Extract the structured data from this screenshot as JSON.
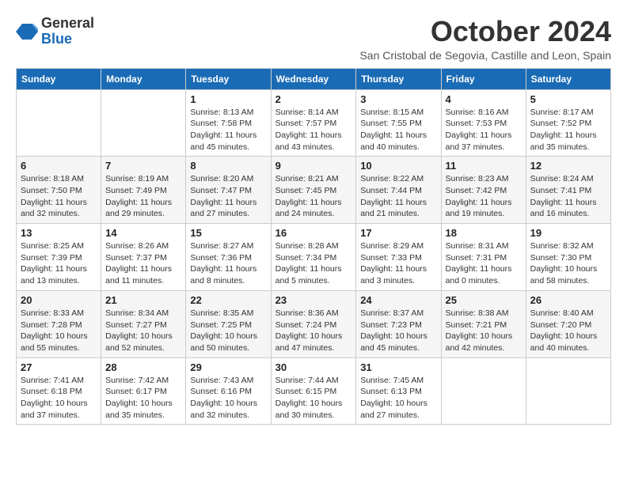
{
  "logo": {
    "general": "General",
    "blue": "Blue"
  },
  "title": "October 2024",
  "subtitle": "San Cristobal de Segovia, Castille and Leon, Spain",
  "weekdays": [
    "Sunday",
    "Monday",
    "Tuesday",
    "Wednesday",
    "Thursday",
    "Friday",
    "Saturday"
  ],
  "weeks": [
    [
      {
        "day": "",
        "info": ""
      },
      {
        "day": "",
        "info": ""
      },
      {
        "day": "1",
        "info": "Sunrise: 8:13 AM\nSunset: 7:58 PM\nDaylight: 11 hours and 45 minutes."
      },
      {
        "day": "2",
        "info": "Sunrise: 8:14 AM\nSunset: 7:57 PM\nDaylight: 11 hours and 43 minutes."
      },
      {
        "day": "3",
        "info": "Sunrise: 8:15 AM\nSunset: 7:55 PM\nDaylight: 11 hours and 40 minutes."
      },
      {
        "day": "4",
        "info": "Sunrise: 8:16 AM\nSunset: 7:53 PM\nDaylight: 11 hours and 37 minutes."
      },
      {
        "day": "5",
        "info": "Sunrise: 8:17 AM\nSunset: 7:52 PM\nDaylight: 11 hours and 35 minutes."
      }
    ],
    [
      {
        "day": "6",
        "info": "Sunrise: 8:18 AM\nSunset: 7:50 PM\nDaylight: 11 hours and 32 minutes."
      },
      {
        "day": "7",
        "info": "Sunrise: 8:19 AM\nSunset: 7:49 PM\nDaylight: 11 hours and 29 minutes."
      },
      {
        "day": "8",
        "info": "Sunrise: 8:20 AM\nSunset: 7:47 PM\nDaylight: 11 hours and 27 minutes."
      },
      {
        "day": "9",
        "info": "Sunrise: 8:21 AM\nSunset: 7:45 PM\nDaylight: 11 hours and 24 minutes."
      },
      {
        "day": "10",
        "info": "Sunrise: 8:22 AM\nSunset: 7:44 PM\nDaylight: 11 hours and 21 minutes."
      },
      {
        "day": "11",
        "info": "Sunrise: 8:23 AM\nSunset: 7:42 PM\nDaylight: 11 hours and 19 minutes."
      },
      {
        "day": "12",
        "info": "Sunrise: 8:24 AM\nSunset: 7:41 PM\nDaylight: 11 hours and 16 minutes."
      }
    ],
    [
      {
        "day": "13",
        "info": "Sunrise: 8:25 AM\nSunset: 7:39 PM\nDaylight: 11 hours and 13 minutes."
      },
      {
        "day": "14",
        "info": "Sunrise: 8:26 AM\nSunset: 7:37 PM\nDaylight: 11 hours and 11 minutes."
      },
      {
        "day": "15",
        "info": "Sunrise: 8:27 AM\nSunset: 7:36 PM\nDaylight: 11 hours and 8 minutes."
      },
      {
        "day": "16",
        "info": "Sunrise: 8:28 AM\nSunset: 7:34 PM\nDaylight: 11 hours and 5 minutes."
      },
      {
        "day": "17",
        "info": "Sunrise: 8:29 AM\nSunset: 7:33 PM\nDaylight: 11 hours and 3 minutes."
      },
      {
        "day": "18",
        "info": "Sunrise: 8:31 AM\nSunset: 7:31 PM\nDaylight: 11 hours and 0 minutes."
      },
      {
        "day": "19",
        "info": "Sunrise: 8:32 AM\nSunset: 7:30 PM\nDaylight: 10 hours and 58 minutes."
      }
    ],
    [
      {
        "day": "20",
        "info": "Sunrise: 8:33 AM\nSunset: 7:28 PM\nDaylight: 10 hours and 55 minutes."
      },
      {
        "day": "21",
        "info": "Sunrise: 8:34 AM\nSunset: 7:27 PM\nDaylight: 10 hours and 52 minutes."
      },
      {
        "day": "22",
        "info": "Sunrise: 8:35 AM\nSunset: 7:25 PM\nDaylight: 10 hours and 50 minutes."
      },
      {
        "day": "23",
        "info": "Sunrise: 8:36 AM\nSunset: 7:24 PM\nDaylight: 10 hours and 47 minutes."
      },
      {
        "day": "24",
        "info": "Sunrise: 8:37 AM\nSunset: 7:23 PM\nDaylight: 10 hours and 45 minutes."
      },
      {
        "day": "25",
        "info": "Sunrise: 8:38 AM\nSunset: 7:21 PM\nDaylight: 10 hours and 42 minutes."
      },
      {
        "day": "26",
        "info": "Sunrise: 8:40 AM\nSunset: 7:20 PM\nDaylight: 10 hours and 40 minutes."
      }
    ],
    [
      {
        "day": "27",
        "info": "Sunrise: 7:41 AM\nSunset: 6:18 PM\nDaylight: 10 hours and 37 minutes."
      },
      {
        "day": "28",
        "info": "Sunrise: 7:42 AM\nSunset: 6:17 PM\nDaylight: 10 hours and 35 minutes."
      },
      {
        "day": "29",
        "info": "Sunrise: 7:43 AM\nSunset: 6:16 PM\nDaylight: 10 hours and 32 minutes."
      },
      {
        "day": "30",
        "info": "Sunrise: 7:44 AM\nSunset: 6:15 PM\nDaylight: 10 hours and 30 minutes."
      },
      {
        "day": "31",
        "info": "Sunrise: 7:45 AM\nSunset: 6:13 PM\nDaylight: 10 hours and 27 minutes."
      },
      {
        "day": "",
        "info": ""
      },
      {
        "day": "",
        "info": ""
      }
    ]
  ]
}
